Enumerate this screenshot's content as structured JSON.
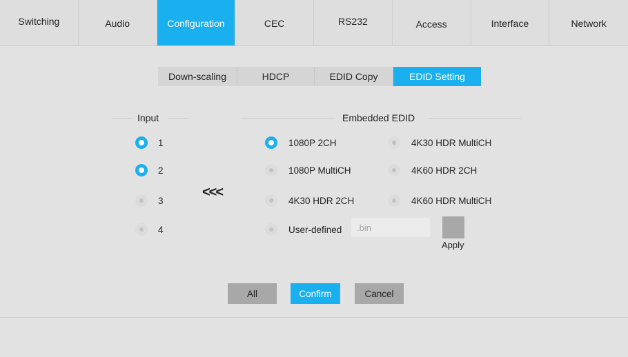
{
  "nav": {
    "tabs": [
      {
        "label": "Switching",
        "active": false
      },
      {
        "label": "Audio",
        "active": false
      },
      {
        "label": "Configuration",
        "active": true
      },
      {
        "label": "CEC",
        "active": false
      },
      {
        "label": "RS232",
        "active": false
      },
      {
        "label": "Access",
        "active": false
      },
      {
        "label": "Interface",
        "active": false
      },
      {
        "label": "Network",
        "active": false
      }
    ]
  },
  "subtabs": [
    {
      "label": "Down-scaling",
      "active": false
    },
    {
      "label": "HDCP",
      "active": false
    },
    {
      "label": "EDID Copy",
      "active": false
    },
    {
      "label": "EDID Setting",
      "active": true
    }
  ],
  "input_section": {
    "title": "Input",
    "items": [
      {
        "label": "1",
        "checked": true
      },
      {
        "label": "2",
        "checked": true
      },
      {
        "label": "3",
        "checked": false
      },
      {
        "label": "4",
        "checked": false
      }
    ]
  },
  "copy_arrow": "<<<",
  "edid_section": {
    "title": "Embedded EDID",
    "options": [
      {
        "label": "1080P 2CH",
        "checked": true
      },
      {
        "label": "4K30 HDR MultiCH",
        "checked": false
      },
      {
        "label": "1080P MultiCH",
        "checked": false
      },
      {
        "label": "4K60 HDR 2CH",
        "checked": false
      },
      {
        "label": "4K30 HDR 2CH",
        "checked": false
      },
      {
        "label": "4K60 HDR MultiCH",
        "checked": false
      },
      {
        "label": "User-defined",
        "checked": false
      }
    ],
    "bin_placeholder": ".bin",
    "apply_label": "Apply"
  },
  "buttons": {
    "all": "All",
    "confirm": "Confirm",
    "cancel": "Cancel"
  },
  "colors": {
    "accent": "#1ab0f0",
    "background": "#e2e2e2",
    "button_grey": "#a8a8a8"
  }
}
